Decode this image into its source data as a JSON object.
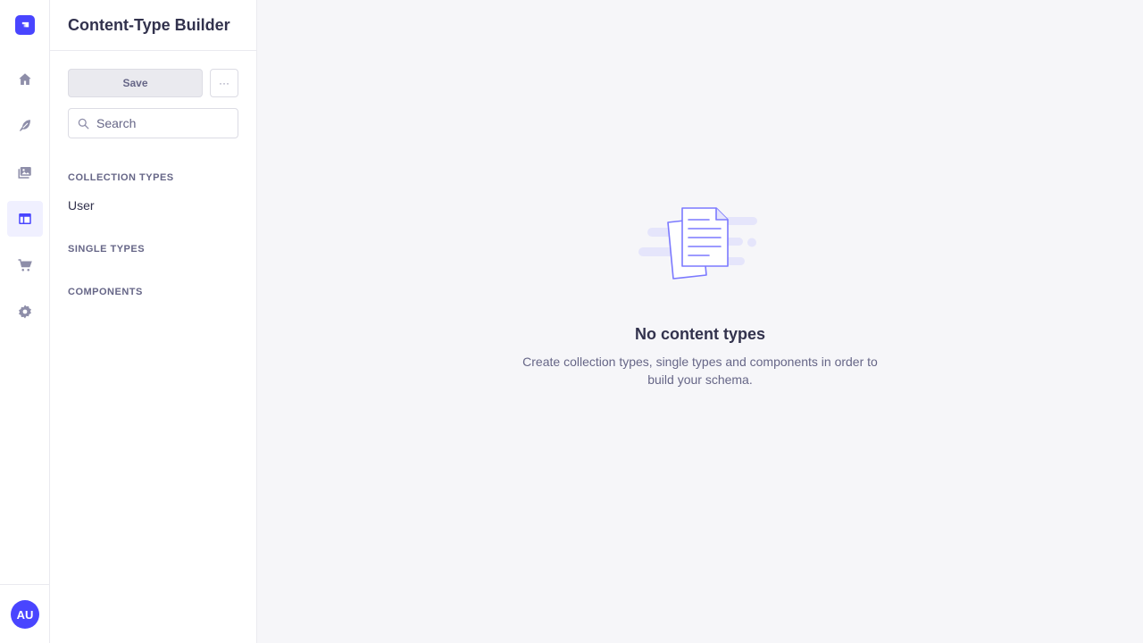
{
  "rail": {
    "items": [
      {
        "name": "home-icon"
      },
      {
        "name": "feather-icon"
      },
      {
        "name": "media-icon"
      },
      {
        "name": "layout-icon",
        "active": true
      },
      {
        "name": "cart-icon"
      },
      {
        "name": "cog-icon"
      }
    ],
    "avatar_initials": "AU"
  },
  "subnav": {
    "title": "Content-Type Builder",
    "save_label": "Save",
    "more_label": "···",
    "search_placeholder": "Search",
    "sections": {
      "collection_types": {
        "label": "COLLECTION TYPES",
        "items": [
          {
            "label": "User"
          }
        ]
      },
      "single_types": {
        "label": "SINGLE TYPES"
      },
      "components": {
        "label": "COMPONENTS"
      }
    }
  },
  "main": {
    "empty_title": "No content types",
    "empty_description": "Create collection types, single types and components in order to build your schema."
  },
  "colors": {
    "accent": "#4945ff",
    "background": "#f6f6f9",
    "text": "#32324d",
    "muted": "#666687"
  }
}
